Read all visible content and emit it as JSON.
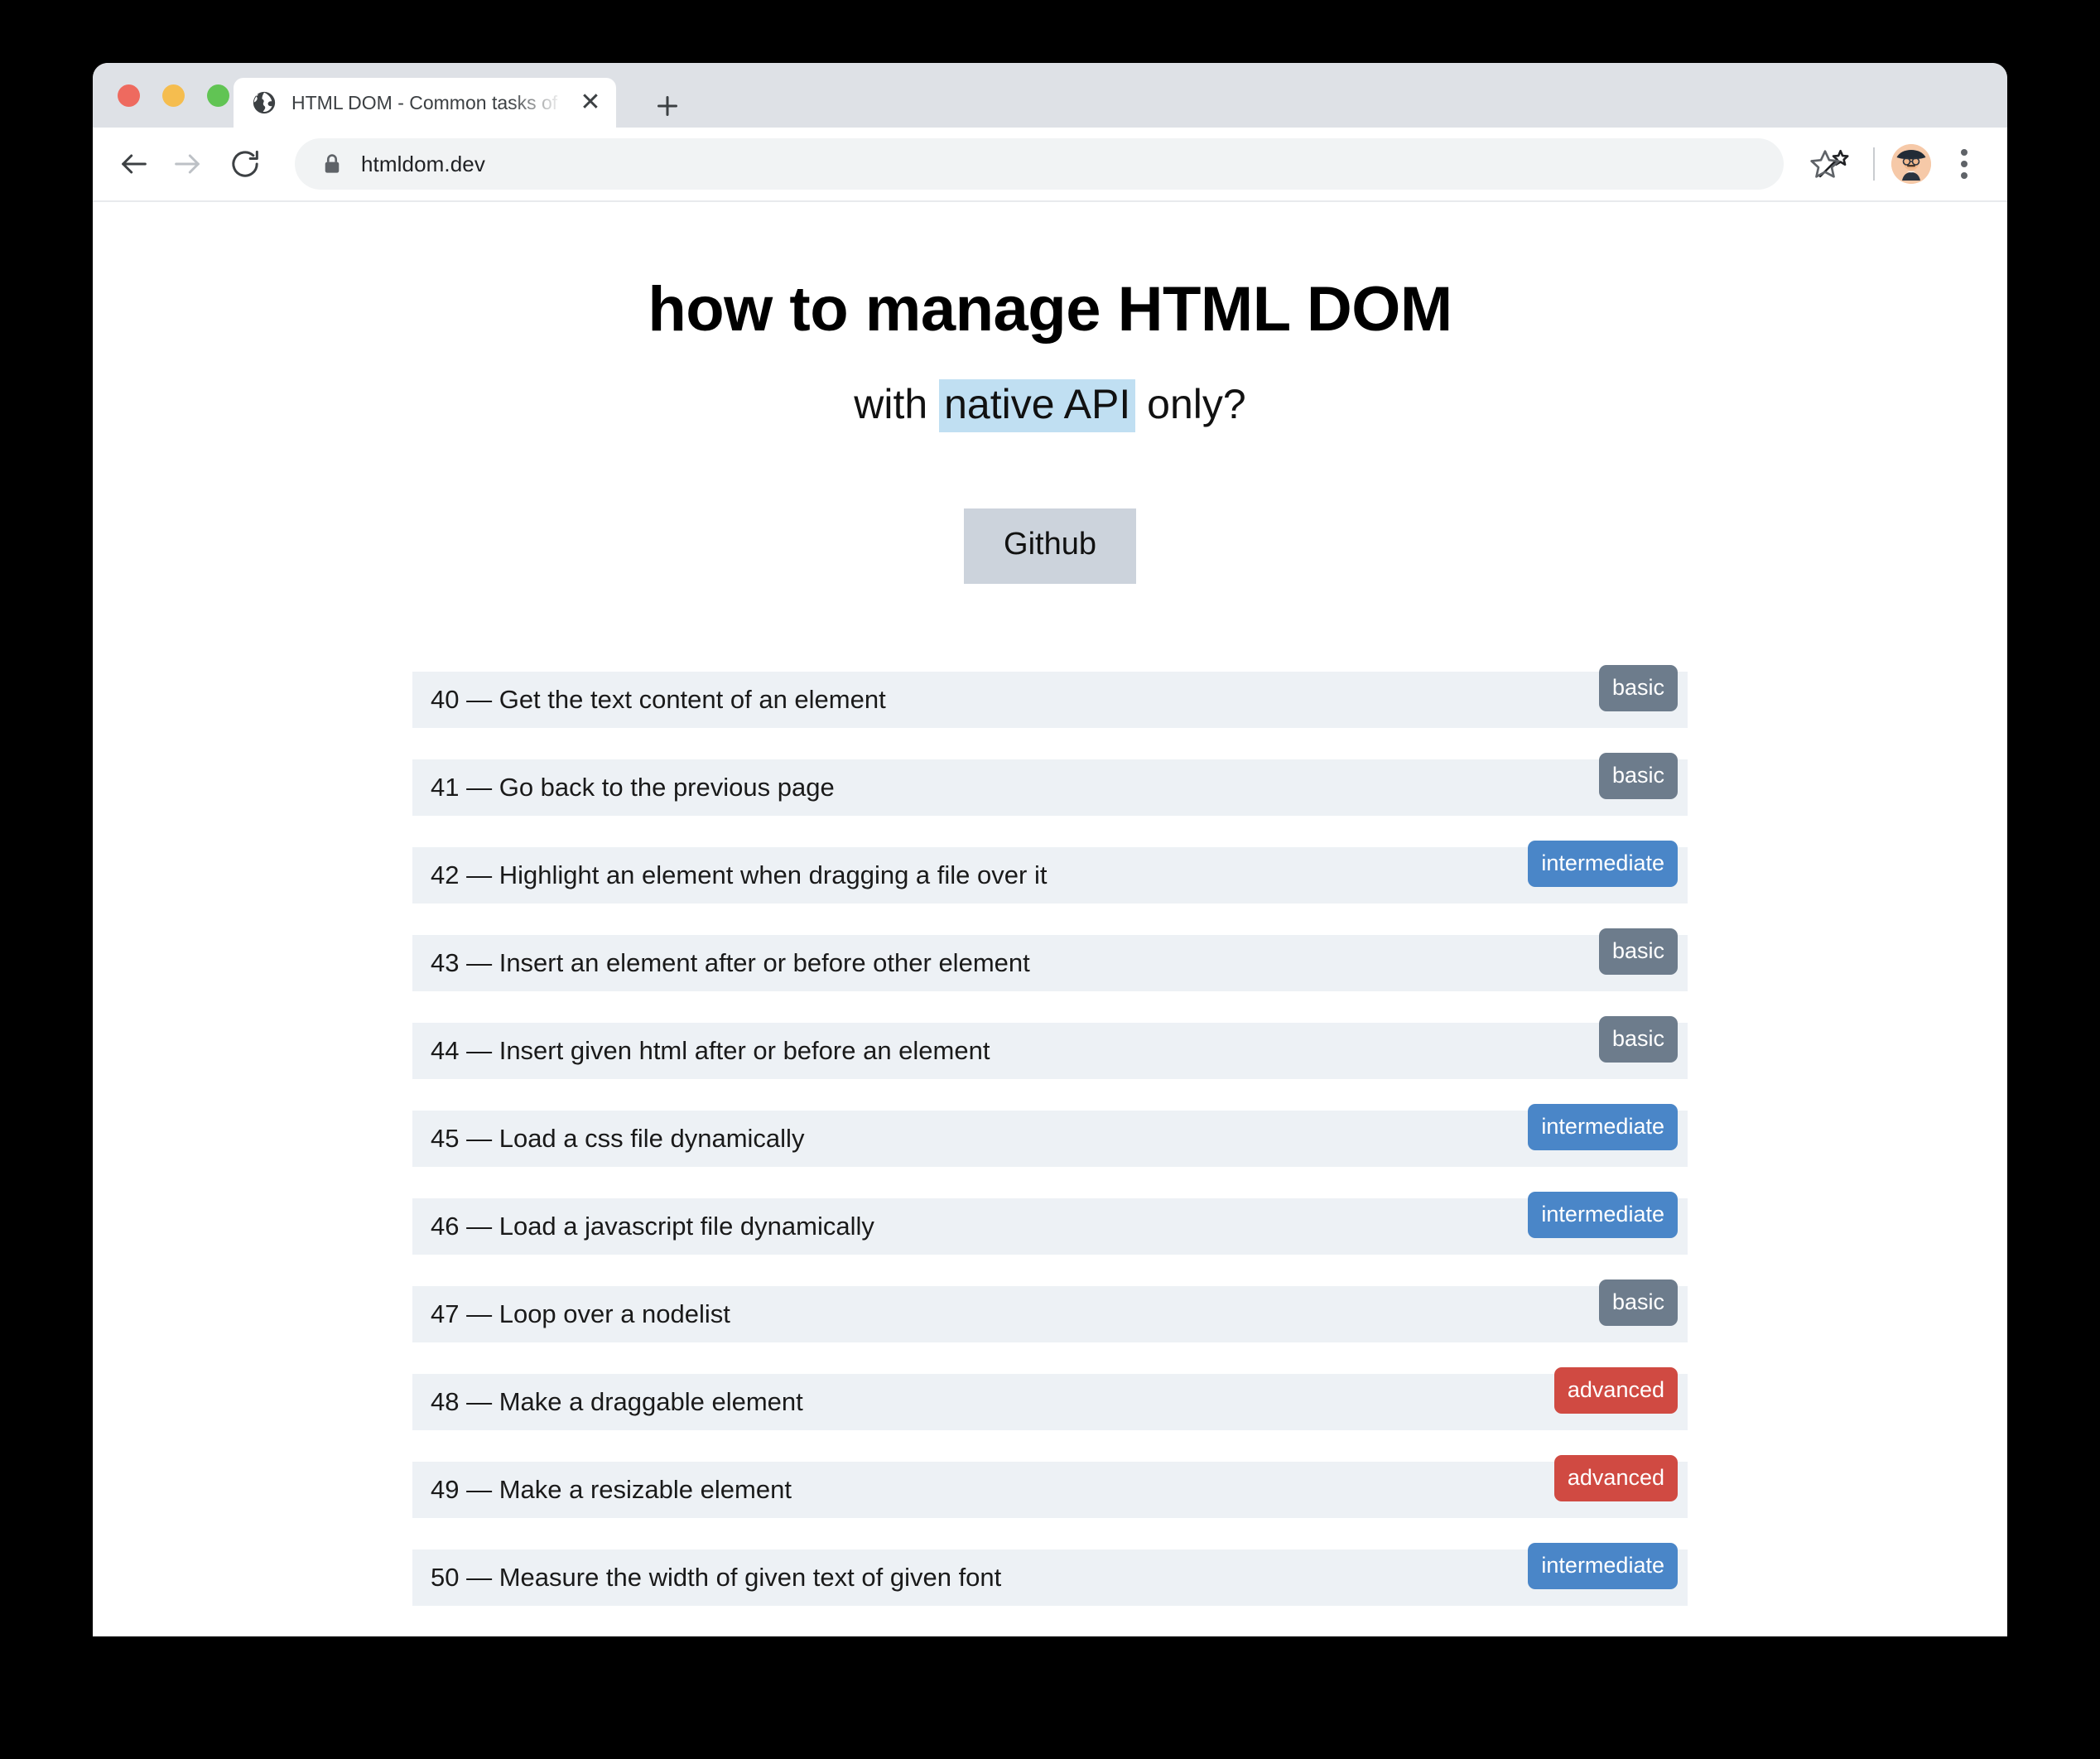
{
  "browser": {
    "traffic_lights": [
      "close",
      "minimize",
      "maximize"
    ],
    "tab": {
      "favicon": "globe-icon",
      "title": "HTML DOM - Common tasks of m",
      "close_label": "✕"
    },
    "new_tab_label": "+",
    "nav": {
      "back_label": "←",
      "forward_label": "→",
      "reload_label": "⟳"
    },
    "omnibox": {
      "lock_icon": "lock-icon",
      "url": "htmldom.dev"
    },
    "actions": {
      "bookmark_icon": "star-icon",
      "extension_icon": "magic-wand-icon",
      "profile_icon": "avatar",
      "menu_icon": "three-dot-menu-icon"
    }
  },
  "page": {
    "heading": "how to manage HTML DOM",
    "subheading_before": "with ",
    "subheading_highlight": "native API",
    "subheading_after": " only?",
    "github_button": "Github",
    "items": [
      {
        "number": "40",
        "dash": " — ",
        "title": "Get the text content of an element",
        "level": "basic"
      },
      {
        "number": "41",
        "dash": " — ",
        "title": "Go back to the previous page",
        "level": "basic"
      },
      {
        "number": "42",
        "dash": " — ",
        "title": "Highlight an element when dragging a file over it",
        "level": "intermediate"
      },
      {
        "number": "43",
        "dash": " — ",
        "title": "Insert an element after or before other element",
        "level": "basic"
      },
      {
        "number": "44",
        "dash": " — ",
        "title": "Insert given html after or before an element",
        "level": "basic"
      },
      {
        "number": "45",
        "dash": " — ",
        "title": "Load a css file dynamically",
        "level": "intermediate"
      },
      {
        "number": "46",
        "dash": " — ",
        "title": "Load a javascript file dynamically",
        "level": "intermediate"
      },
      {
        "number": "47",
        "dash": " — ",
        "title": "Loop over a nodelist",
        "level": "basic"
      },
      {
        "number": "48",
        "dash": " — ",
        "title": "Make a draggable element",
        "level": "advanced"
      },
      {
        "number": "49",
        "dash": " — ",
        "title": "Make a resizable element",
        "level": "advanced"
      },
      {
        "number": "50",
        "dash": " — ",
        "title": "Measure the width of given text of given font",
        "level": "intermediate"
      }
    ]
  },
  "colors": {
    "background": "#000000",
    "tabstrip": "#dee1e6",
    "row_bg": "#edf1f5",
    "highlight": "#c0dff2",
    "github_btn": "#ccd3dc",
    "badge_basic": "#6d7c8c",
    "badge_intermediate": "#4a86c8",
    "badge_advanced": "#d04a42",
    "traffic_red": "#ee6a5f",
    "traffic_yellow": "#f5bd4f",
    "traffic_green": "#61c454"
  }
}
